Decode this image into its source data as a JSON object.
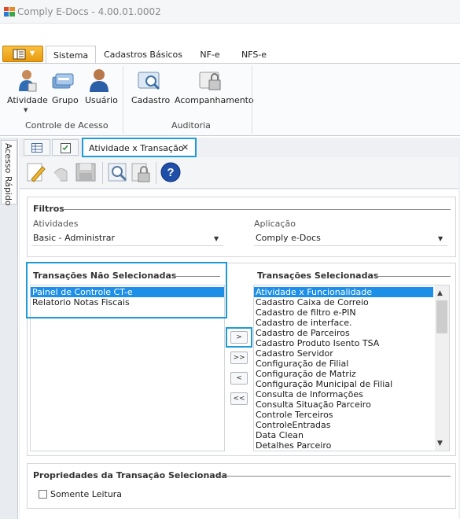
{
  "window": {
    "title": "Comply E-Docs - 4.00.01.0002"
  },
  "menu_tabs": [
    {
      "label": "Sistema"
    },
    {
      "label": "Cadastros Básicos"
    },
    {
      "label": "NF-e"
    },
    {
      "label": "NFS-e"
    }
  ],
  "ribbon": {
    "groups": [
      {
        "label": "Controle de Acesso",
        "buttons": [
          "Atividade",
          "Grupo",
          "Usuário"
        ]
      },
      {
        "label": "Auditoria",
        "buttons": [
          "Cadastro",
          "Acompanhamento"
        ]
      }
    ]
  },
  "quick_access": {
    "label": "Acesso Rápido"
  },
  "doc_tabs": {
    "active_label": "Atividade x Transação",
    "close_glyph": "✕"
  },
  "filters": {
    "title": "Filtros",
    "atividades_label": "Atividades",
    "atividades_value": "Basic - Administrar",
    "aplicacao_label": "Aplicação",
    "aplicacao_value": "Comply e-Docs"
  },
  "unselected": {
    "title": "Transações Não Selecionadas",
    "items": [
      "Painel de Controle CT-e",
      "Relatorio Notas Fiscais"
    ],
    "selected_index": 0
  },
  "selected": {
    "title": "Transações Selecionadas",
    "items": [
      "Atividade x Funcionalidade",
      "Cadastro Caixa de Correio",
      "Cadastro de filtro e-PIN",
      "Cadastro de interface.",
      "Cadastro de Parceiros",
      "Cadastro Produto Isento TSA",
      "Cadastro Servidor",
      "Configuração de Filial",
      "Configuração de Matriz",
      "Configuração Municipal de Filial",
      "Consulta de Informações",
      "Consulta Situação Parceiro",
      "Controle Terceiros",
      "ControleEntradas",
      "Data Clean",
      "Detalhes Parceiro"
    ],
    "selected_index": 0
  },
  "move_buttons": [
    ">",
    ">>",
    "<",
    "<<"
  ],
  "properties": {
    "title": "Propriedades da Transação Selecionada",
    "readonly_label": "Somente Leitura"
  },
  "colors": {
    "accent": "#1e9bd7",
    "selection": "#1e8fe6",
    "menu_orange": "#f0a020"
  }
}
